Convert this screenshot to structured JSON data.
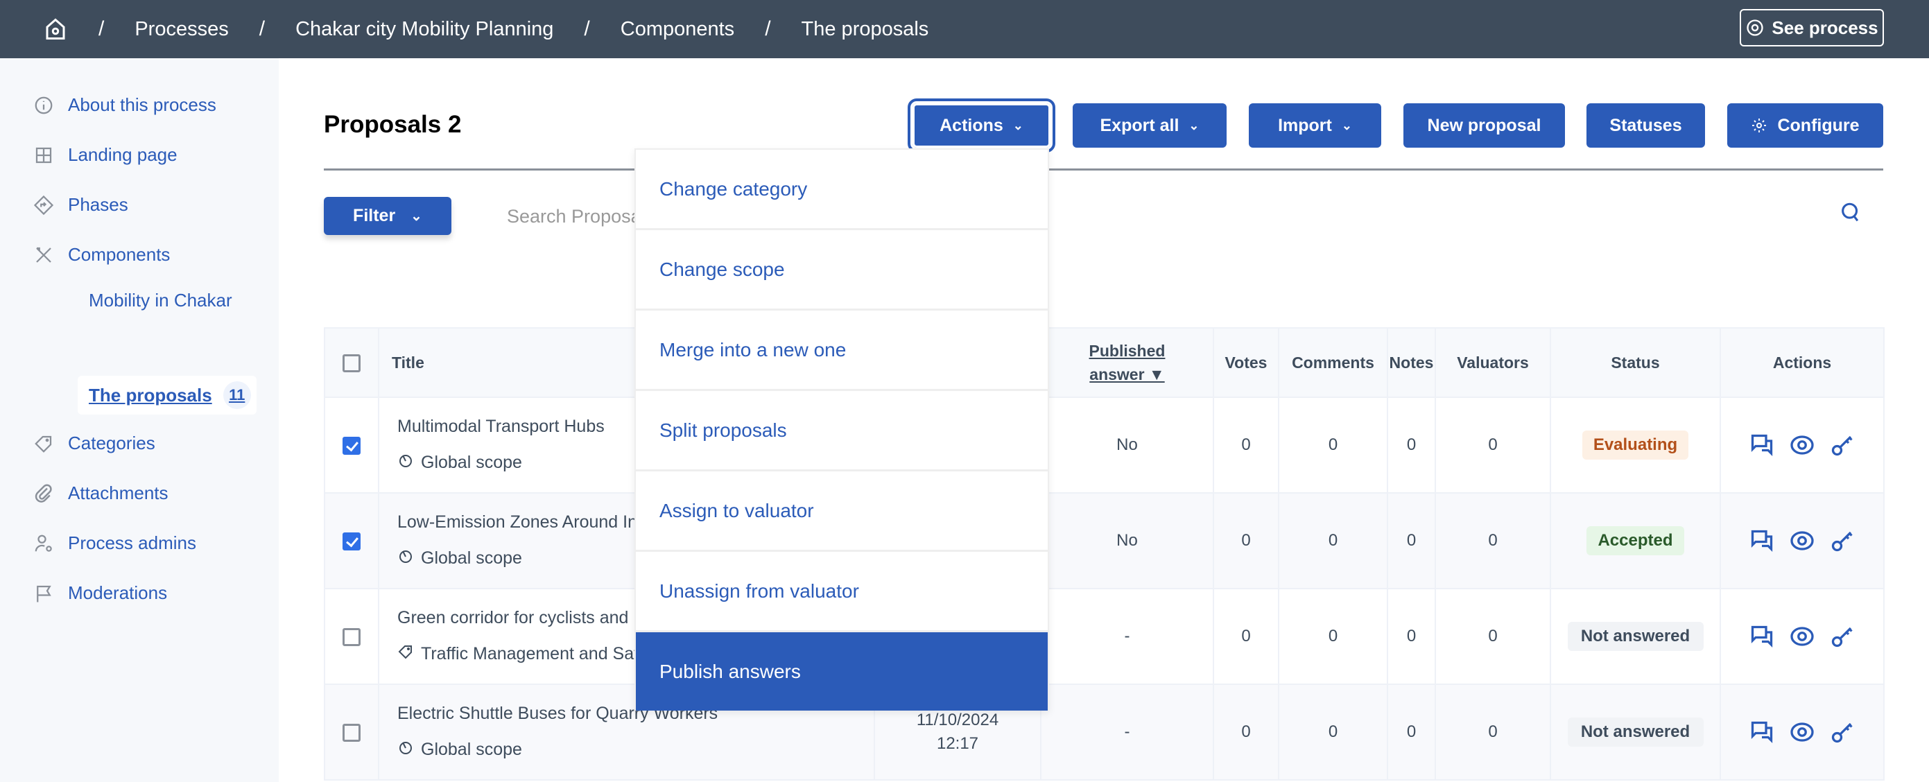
{
  "breadcrumb": {
    "items": [
      "Processes",
      "Chakar city Mobility Planning",
      "Components",
      "The proposals"
    ],
    "separator": "/"
  },
  "see_process": "See process",
  "sidebar": {
    "items": [
      {
        "label": "About this process",
        "icon": "info-icon"
      },
      {
        "label": "Landing page",
        "icon": "layout-icon"
      },
      {
        "label": "Phases",
        "icon": "direction-icon"
      },
      {
        "label": "Components",
        "icon": "tools-icon"
      },
      {
        "label": "Categories",
        "icon": "tag-icon"
      },
      {
        "label": "Attachments",
        "icon": "paperclip-icon"
      },
      {
        "label": "Process admins",
        "icon": "user-gear-icon"
      },
      {
        "label": "Moderations",
        "icon": "flag-icon"
      }
    ],
    "components": [
      {
        "label": "Mobility in Chakar"
      },
      {
        "label": "The proposals",
        "count": "11",
        "active": true
      }
    ]
  },
  "page_title": "Proposals 2",
  "toolbar": {
    "actions": "Actions",
    "export_all": "Export all",
    "import": "Import",
    "new_proposal": "New proposal",
    "statuses": "Statuses",
    "configure": "Configure"
  },
  "filter": "Filter",
  "search": {
    "placeholder": "Search Proposals",
    "value": ""
  },
  "actions_menu": [
    "Change category",
    "Change scope",
    "Merge into a new one",
    "Split proposals",
    "Assign to valuator",
    "Unassign from valuator",
    "Publish answers"
  ],
  "actions_menu_highlighted": "Publish answers",
  "table": {
    "headers": {
      "title": "Title",
      "published_answer": "Published answer ▼",
      "votes": "Votes",
      "comments": "Comments",
      "notes": "Notes",
      "valuators": "Valuators",
      "status": "Status",
      "actions": "Actions"
    },
    "rows": [
      {
        "checked": true,
        "title": "Multimodal Transport Hubs",
        "meta": "Global scope",
        "meta_icon": "scope-icon",
        "date": "",
        "published_answer": "No",
        "votes": "0",
        "comments": "0",
        "notes": "0",
        "valuators": "0",
        "status": "Evaluating",
        "status_kind": "evaluating"
      },
      {
        "checked": true,
        "title": "Low-Emission Zones Around Industrial Areas",
        "meta": "Global scope",
        "meta_icon": "scope-icon",
        "date": "",
        "published_answer": "No",
        "votes": "0",
        "comments": "0",
        "notes": "0",
        "valuators": "0",
        "status": "Accepted",
        "status_kind": "accepted"
      },
      {
        "checked": false,
        "title": "Green corridor for cyclists and pedestrians",
        "meta": "Traffic Management and Safety",
        "meta_icon": "tag-icon",
        "date": "",
        "published_answer": "-",
        "votes": "0",
        "comments": "0",
        "notes": "0",
        "valuators": "0",
        "status": "Not answered",
        "status_kind": "none"
      },
      {
        "checked": false,
        "title": "Electric Shuttle Buses for Quarry Workers",
        "meta": "Global scope",
        "meta_icon": "scope-icon",
        "date": "11/10/2024 12:17",
        "published_answer": "-",
        "votes": "0",
        "comments": "0",
        "notes": "0",
        "valuators": "0",
        "status": "Not answered",
        "status_kind": "none"
      }
    ]
  },
  "colors": {
    "primary": "#2b5bb8",
    "topbar": "#3e4c5c",
    "evaluating_bg": "#fdf0e4",
    "evaluating_fg": "#b3501a",
    "accepted_bg": "#e6f6e6",
    "accepted_fg": "#2a5a2a",
    "none_bg": "#f1f3f6",
    "none_fg": "#3e4c5c"
  }
}
